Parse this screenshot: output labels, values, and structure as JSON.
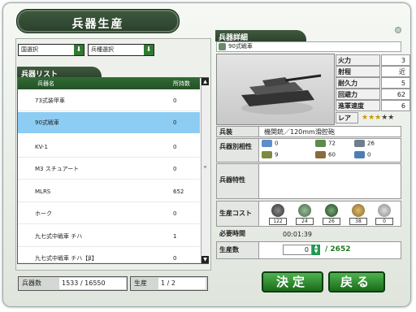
{
  "title": "兵器生産",
  "filters": {
    "country": "国選択",
    "type": "兵種選択"
  },
  "list": {
    "tab_label": "兵器リスト",
    "col_name": "兵器名",
    "col_owned": "所持数",
    "rows": [
      {
        "name": "73式装甲車",
        "owned": "0"
      },
      {
        "name": "90式戦車",
        "owned": "0"
      },
      {
        "name": "KV-1",
        "owned": "0"
      },
      {
        "name": "M3 スチュアート",
        "owned": "0"
      },
      {
        "name": "MLRS",
        "owned": "652"
      },
      {
        "name": "ホーク",
        "owned": "0"
      },
      {
        "name": "九七式中戦車 チハ",
        "owned": "1"
      },
      {
        "name": "九七式中戦車 チハ【β】",
        "owned": "0"
      }
    ]
  },
  "footer": {
    "count_label": "兵器数",
    "count_value": "1533 / 16550",
    "prod_label": "生産",
    "prod_value": "1 / 2"
  },
  "detail": {
    "tab_label": "兵器詳細",
    "weapon_name": "90式戦車",
    "stats": [
      {
        "label": "火力",
        "value": "3"
      },
      {
        "label": "射程",
        "value": "近"
      },
      {
        "label": "耐久力",
        "value": "5"
      },
      {
        "label": "回避力",
        "value": "62"
      },
      {
        "label": "進軍速度",
        "value": "6"
      }
    ],
    "rarity_label": "レア",
    "rarity_stars": 3,
    "rarity_max": 5,
    "equip_label": "兵装",
    "equip_value": "機関銃／120mm滑腔砲",
    "affinity_label": "兵器別相性",
    "affinity": [
      {
        "icon": "plane-icon",
        "value": "0"
      },
      {
        "icon": "tank-icon",
        "value": "72"
      },
      {
        "icon": "ship-icon",
        "value": "26"
      },
      {
        "icon": "artillery-icon",
        "value": "9"
      },
      {
        "icon": "truck-icon",
        "value": "60"
      },
      {
        "icon": "submarine-icon",
        "value": "0"
      }
    ],
    "trait_label": "兵器特性",
    "cost_label": "生産コスト",
    "costs": [
      {
        "icon": "helmet-icon",
        "value": "122"
      },
      {
        "icon": "oil-drum-icon",
        "value": "24"
      },
      {
        "icon": "soldier-icon",
        "value": "26"
      },
      {
        "icon": "steel-icon",
        "value": "38"
      },
      {
        "icon": "coin-icon",
        "value": "0"
      }
    ],
    "time_label": "必要時間",
    "time_value": "00:01:39",
    "qty_label": "生産数",
    "qty_value": "0",
    "qty_max": "/ 2652"
  },
  "buttons": {
    "confirm": "決定",
    "back": "戻る"
  },
  "colors": {
    "accent_green": "#2f7a2f",
    "selection_blue": "#8ecdf3"
  }
}
